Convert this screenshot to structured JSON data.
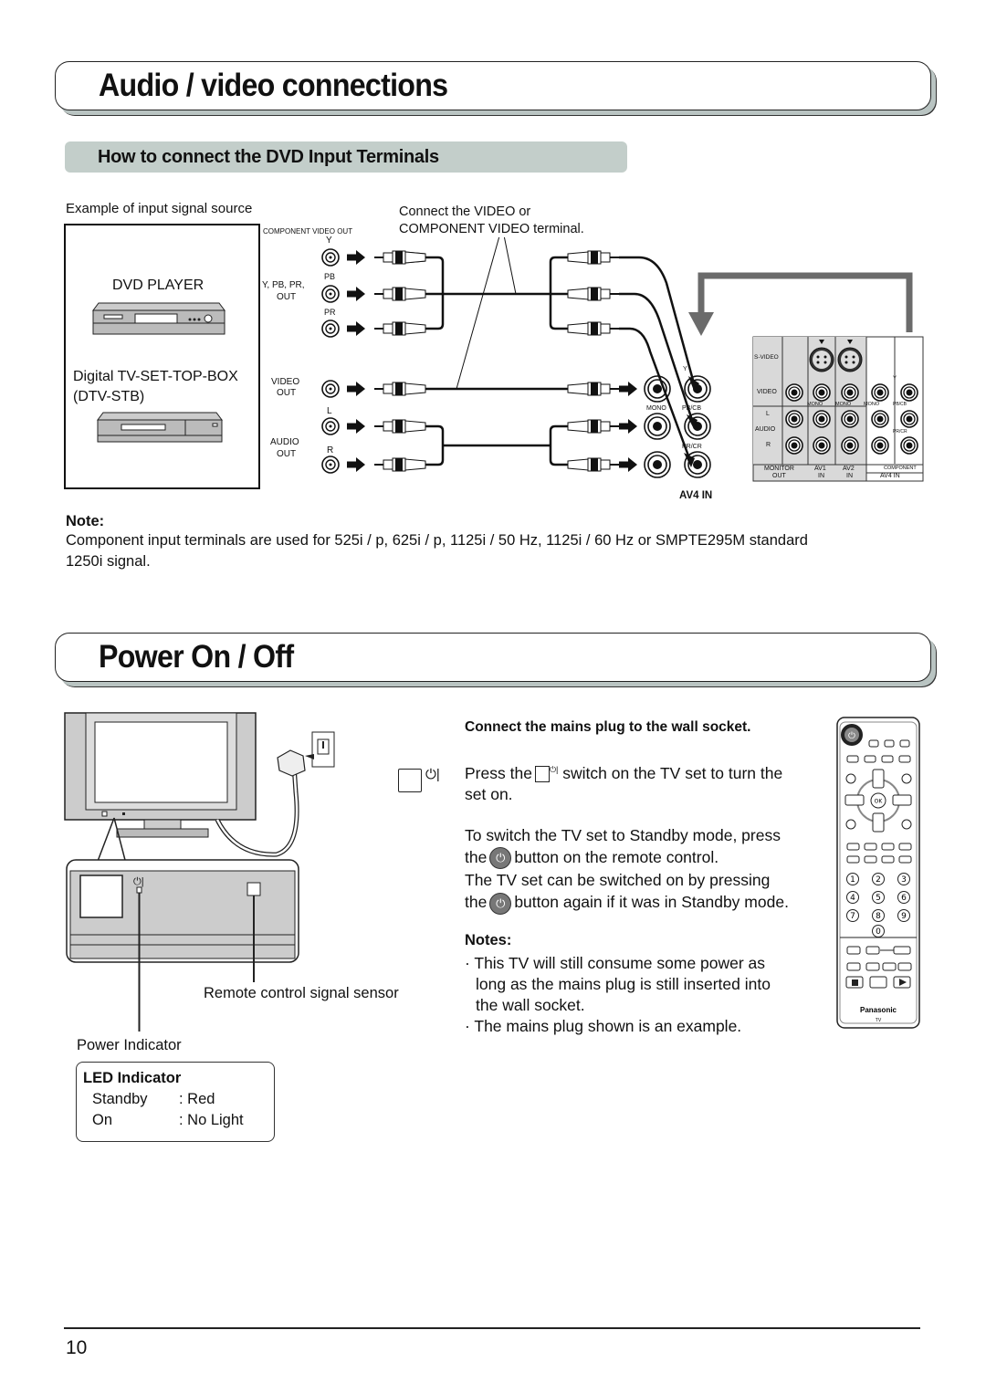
{
  "section1": {
    "title": "Audio / video connections",
    "subtitle": "How to connect the DVD Input Terminals",
    "source_label": "Example of input signal source",
    "devices": [
      "DVD PLAYER",
      "Digital TV-SET-TOP-BOX",
      "(DTV-STB)"
    ],
    "callout": [
      "Connect the VIDEO or",
      "COMPONENT VIDEO terminal."
    ],
    "output_labels": {
      "component_video_out": "COMPONENT VIDEO OUT",
      "y": "Y",
      "ypbpr_out_line1": "Y, PB, PR,",
      "ypbpr_out_line2": "OUT",
      "pb": "PB",
      "pr": "PR",
      "video_out_line1": "VIDEO",
      "video_out_line2": "OUT",
      "l": "L",
      "audio_out_line1": "AUDIO",
      "audio_out_line2": "OUT",
      "r": "R"
    },
    "terminal_labels": {
      "mono": "MONO",
      "y": "Y",
      "pb_cb": "PB/CB",
      "pr_cr": "PR/CR",
      "av4_in": "AV4 IN"
    },
    "panel_labels": {
      "s_video": "S-VIDEO",
      "video": "VIDEO",
      "audio": "AUDIO",
      "l": "L",
      "r": "R",
      "mono": "MONO",
      "y": "Y",
      "pbcb": "PB/CB",
      "prcr": "PR/CR",
      "monitor_out": [
        "MONITOR",
        "OUT"
      ],
      "av1_in": [
        "AV1",
        "IN"
      ],
      "av2_in": [
        "AV2",
        "IN"
      ],
      "component": "COMPONENT",
      "av4_in": "AV4 IN"
    },
    "note_heading": "Note:",
    "note_lines": [
      "Component input terminals are used for 525i / p, 625i / p, 1125i / 50 Hz, 1125i / 60 Hz or SMPTE295M standard",
      "1250i signal."
    ]
  },
  "section2": {
    "title": "Power On / Off",
    "instruction_heading": "Connect the mains plug to the wall socket.",
    "para1": {
      "before": "Press the",
      "after": "switch on the TV set to turn the",
      "line2": "set on."
    },
    "para2": {
      "line1": "To switch the TV set to Standby mode, press",
      "line2_before": "the",
      "line2_after": "button on the remote control.",
      "line3": "The TV set can be switched on by pressing",
      "line4_before": "the",
      "line4_after": "button again if it was in Standby mode."
    },
    "notes_heading": "Notes:",
    "notes": [
      [
        "This TV will still consume some power as",
        "long as the mains plug is still inserted into",
        "the wall socket."
      ],
      [
        "The mains plug shown is an example."
      ]
    ],
    "labels": {
      "remote_sensor": "Remote control signal sensor",
      "power_indicator": "Power Indicator"
    },
    "led": {
      "heading": "LED Indicator",
      "rows": [
        {
          "state": "Standby",
          "value": ": Red"
        },
        {
          "state": "On",
          "value": ": No Light"
        }
      ]
    },
    "remote": {
      "brand": "Panasonic",
      "model": "TV",
      "ok_label": "OK",
      "digits": [
        "1",
        "2",
        "3",
        "4",
        "5",
        "6",
        "7",
        "8",
        "9",
        "0"
      ]
    },
    "power_symbol": "⏻|"
  },
  "footer": {
    "page_number": "10"
  },
  "colors": {
    "banner_shadow": "#b9c4c2",
    "subbar": "#c3ceca",
    "arrow_gray": "#6b6b6b",
    "panel_gray": "#d9d9d9"
  }
}
